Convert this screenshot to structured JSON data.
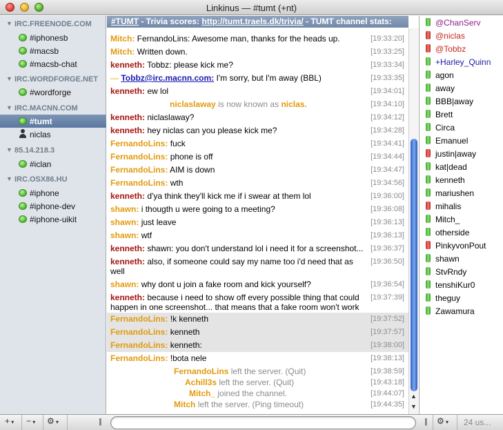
{
  "window": {
    "title": "Linkinus — #tumt (+nt)"
  },
  "sidebar": {
    "servers": [
      {
        "name": "IRC.FREENODE.COM",
        "items": [
          "#iphonesb",
          "#macsb",
          "#macsb-chat"
        ]
      },
      {
        "name": "IRC.WORDFORGE.NET",
        "items": [
          "#wordforge"
        ]
      },
      {
        "name": "IRC.MACNN.COM",
        "items": [
          "#tumt",
          "niclas"
        ]
      },
      {
        "name": "85.14.218.3",
        "items": [
          "#iclan"
        ]
      },
      {
        "name": "IRC.OSX86.HU",
        "items": [
          "#iphone",
          "#iphone-dev",
          "#iphone-uikit"
        ]
      }
    ]
  },
  "chat": {
    "topic": {
      "channel": "#TUMT",
      "prefix": "- Trivia scores:",
      "url": "http://tumt.traels.dk/trivia/",
      "suffix": "- TUMT channel stats:"
    },
    "messages": [
      {
        "nick": "Mitch:",
        "text": "FernandoLins: Awesome man, thanks for the heads up.",
        "time": "[19:33:20]"
      },
      {
        "nick": "Mitch:",
        "text": "Written down.",
        "time": "[19:33:25]"
      },
      {
        "nick": "kenneth:",
        "text": "Tobbz: please kick me?",
        "time": "[19:33:34]"
      },
      {
        "nick": "Tobbz@irc.macnn.com:",
        "text": "I'm sorry, but I'm away (BBL)",
        "time": "[19:33:35]"
      },
      {
        "nick": "kenneth:",
        "text": "ew lol",
        "time": "[19:34:01]"
      },
      {
        "event_nick": "niclaslaway",
        "event_text": "is now known as",
        "event_target": "niclas.",
        "time": "[19:34:10]"
      },
      {
        "nick": "kenneth:",
        "text": "niclaslaway?",
        "time": "[19:34:12]"
      },
      {
        "nick": "kenneth:",
        "text": "hey niclas can you please kick me?",
        "time": "[19:34:28]"
      },
      {
        "nick": "FernandoLins:",
        "text": "fuck",
        "time": "[19:34:41]"
      },
      {
        "nick": "FernandoLins:",
        "text": "phone is off",
        "time": "[19:34:44]"
      },
      {
        "nick": "FernandoLins:",
        "text": "AIM is down",
        "time": "[19:34:47]"
      },
      {
        "nick": "FernandoLins:",
        "text": "wth",
        "time": "[19:34:56]"
      },
      {
        "nick": "kenneth:",
        "text": "d'ya think they'll kick me if i swear at them lol",
        "time": "[19:36:00]"
      },
      {
        "nick": "shawn:",
        "text": "i thougth u were going to a meeting?",
        "time": "[19:36:08]"
      },
      {
        "nick": "shawn:",
        "text": "just leave",
        "time": "[19:36:13]"
      },
      {
        "nick": "shawn:",
        "text": "wtf",
        "time": "[19:36:13]"
      },
      {
        "nick": "kenneth:",
        "text": "shawn: you don't understand lol i need it for a screenshot...",
        "time": "[19:36:37]"
      },
      {
        "nick": "kenneth:",
        "text": "also, if someone could say my name too i'd need that as",
        "text2": "well",
        "time": "[19:36:50]"
      },
      {
        "nick": "shawn:",
        "text": "why dont u join a fake room and kick yourself?",
        "time": "[19:36:54]"
      },
      {
        "nick": "kenneth:",
        "text": "because i need to show off every possible thing that could",
        "text2": "happen in one screenshot... that means that a fake room won't work",
        "time": "[19:37:39]"
      },
      {
        "nick": "FernandoLins:",
        "text": "!k kenneth",
        "time": "[19:37:52]"
      },
      {
        "nick": "FernandoLins:",
        "text": "kenneth",
        "time": "[19:37:57]"
      },
      {
        "nick": "FernandoLins:",
        "text": "kenneth:",
        "time": "[19:38:00]"
      },
      {
        "nick": "FernandoLins:",
        "text": "!bota nele",
        "time": "[19:38:13]"
      },
      {
        "event_nick": "FernandoLins",
        "event_text": "left the server. (Quit)",
        "time": "[19:38:59]"
      },
      {
        "event_nick": "Achill3s",
        "event_text": "left the server. (Quit)",
        "time": "[19:43:18]"
      },
      {
        "event_nick": "Mitch_",
        "event_text": "joined the channel.",
        "time": "[19:44:07]"
      },
      {
        "event_nick": "Mitch",
        "event_text": "left the server. (Ping timeout)",
        "time": "[19:44:35]"
      }
    ]
  },
  "users": {
    "list": [
      "@ChanServ",
      "@niclas",
      "@Tobbz",
      "+Harley_Quinn",
      "agon",
      "away",
      "BBB|away",
      "Brett",
      "Circa",
      "Emanuel",
      "justin|away",
      "kat|dead",
      "kenneth",
      "mariushen",
      "mihalis",
      "Mitch_",
      "otherside",
      "PinkyvonPout",
      "shawn",
      "StvRndy",
      "tenshiKur0",
      "theguy",
      "Zawamura"
    ],
    "away_users": [
      "@niclas",
      "@Tobbz",
      "justin|away",
      "mihalis",
      "PinkyvonPout"
    ]
  },
  "bottom": {
    "add_label": "+",
    "remove_label": "−",
    "gear_label": "⚙",
    "user_count": "24 us..."
  }
}
